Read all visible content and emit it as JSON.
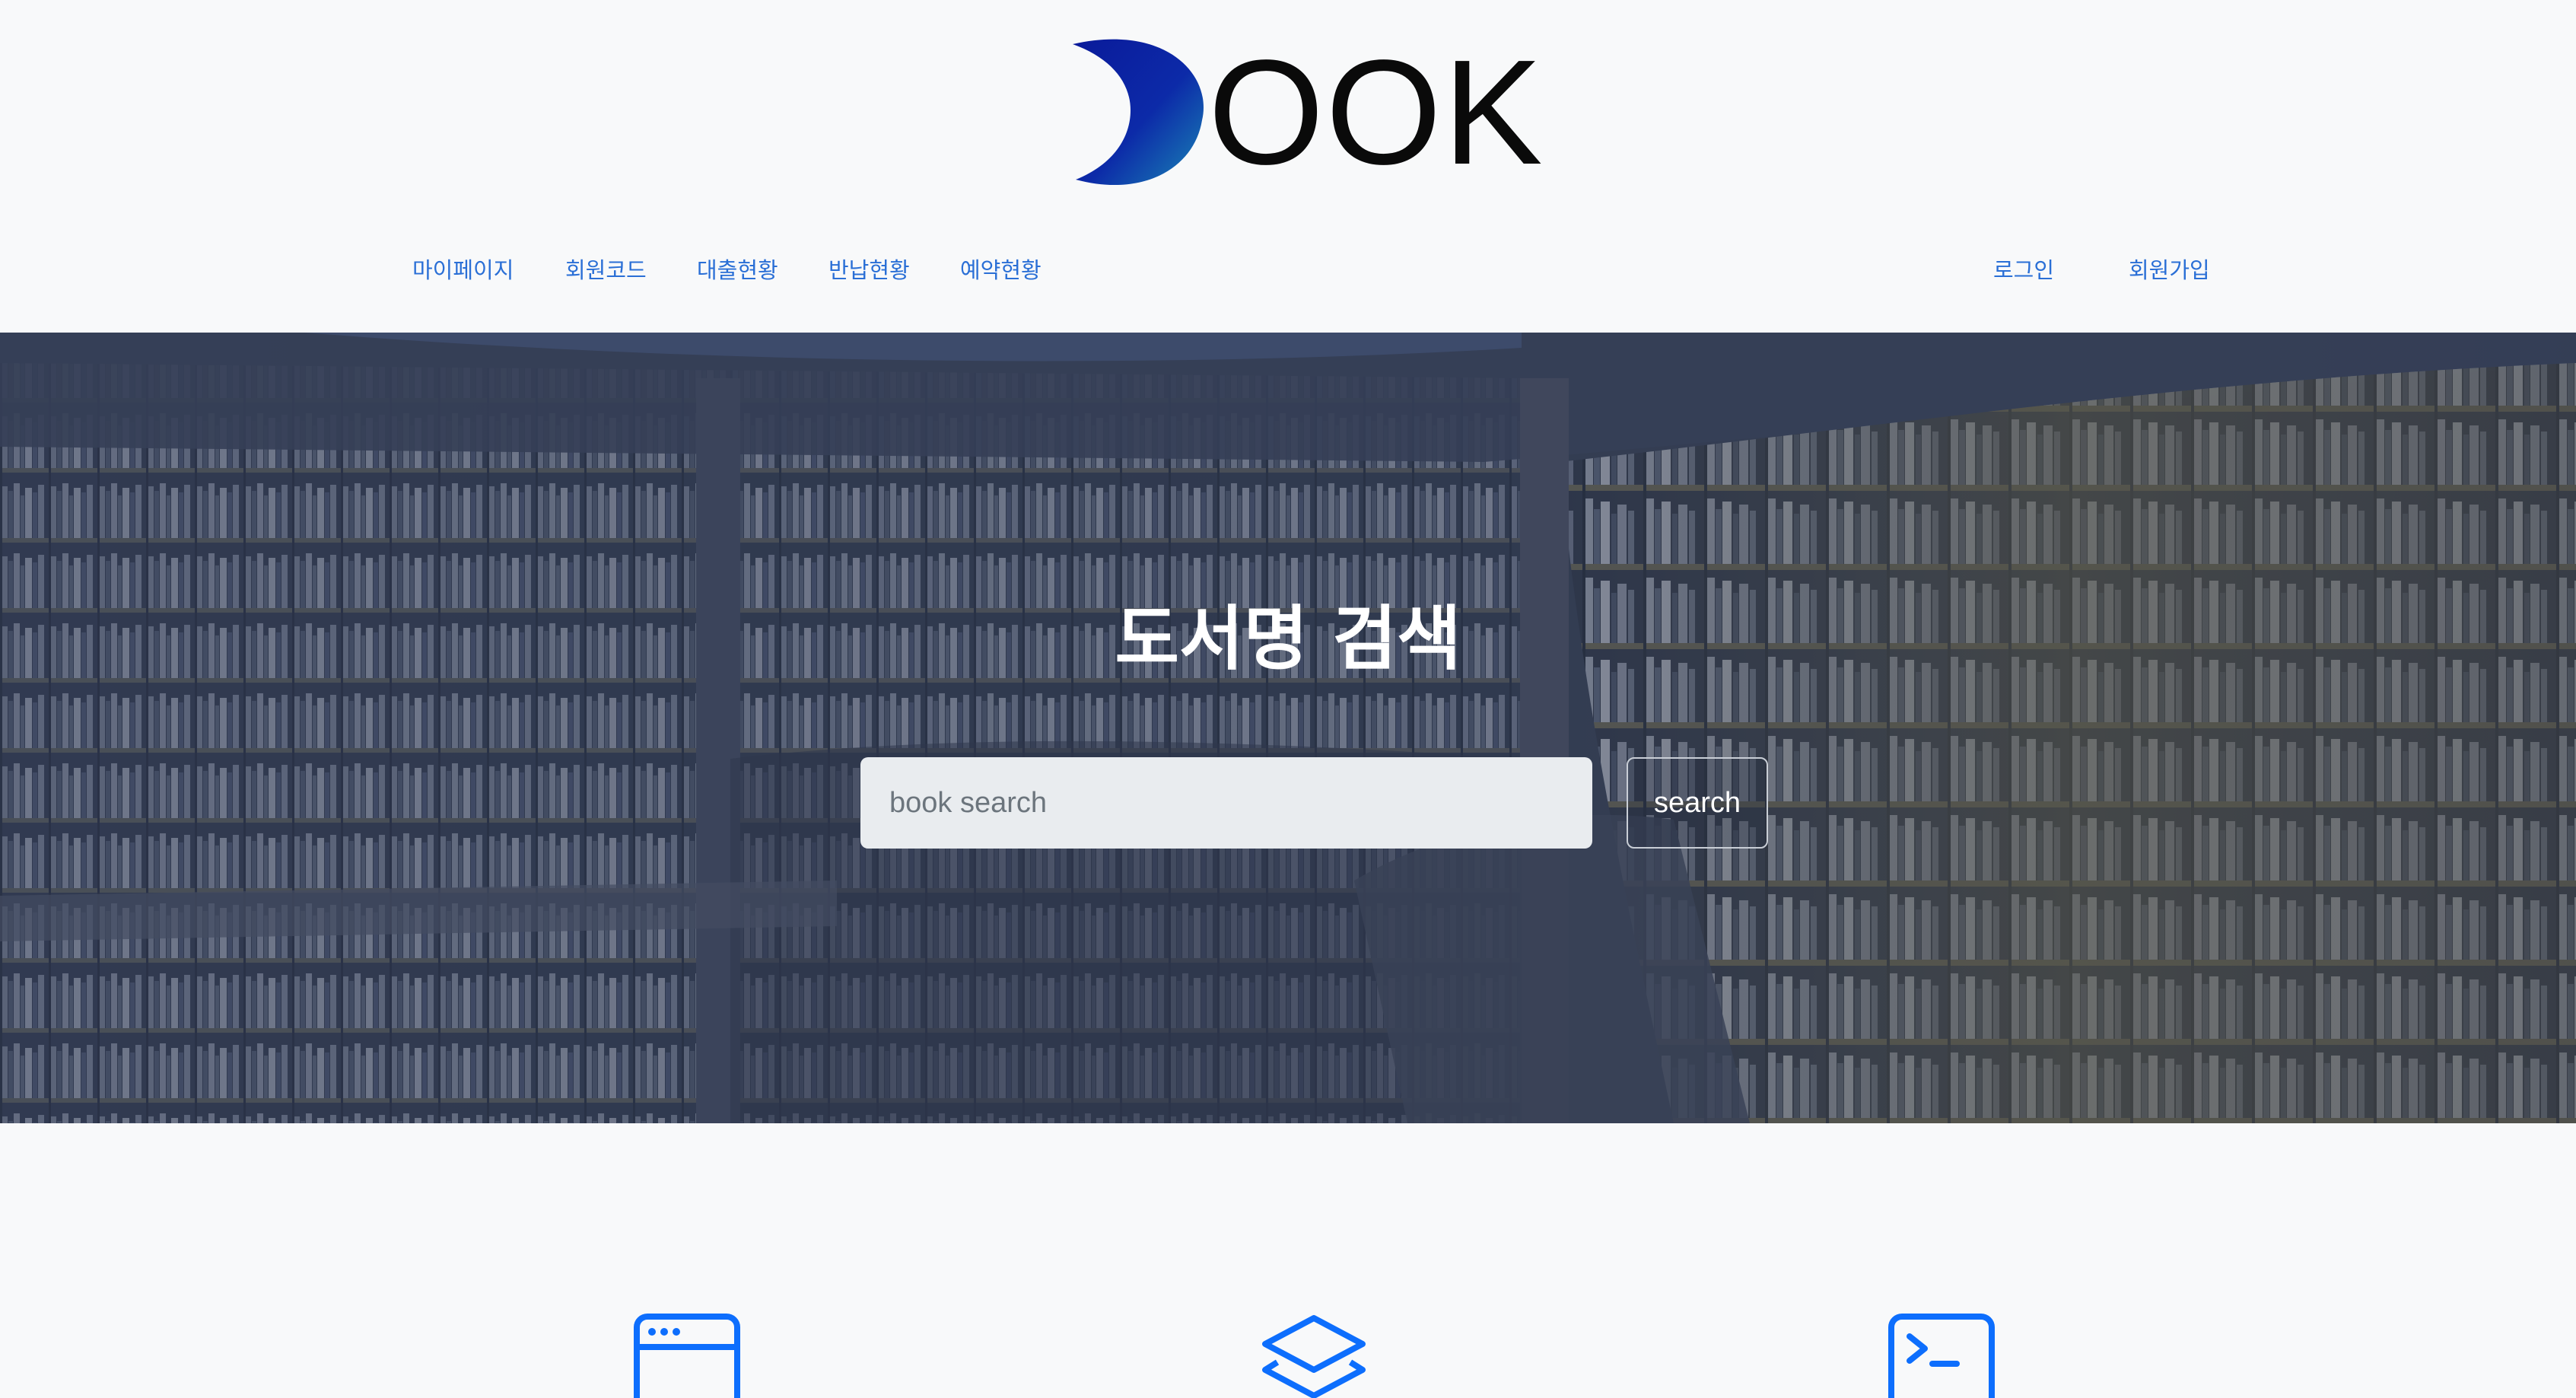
{
  "header": {
    "logo_text": "OOK",
    "brand_colors": {
      "crescent_start": "#0a1a9a",
      "crescent_end": "#1a7fb5"
    }
  },
  "nav": {
    "left": [
      {
        "label": "마이페이지"
      },
      {
        "label": "회원코드"
      },
      {
        "label": "대출현황"
      },
      {
        "label": "반납현황"
      },
      {
        "label": "예약현황"
      }
    ],
    "right": [
      {
        "label": "로그인"
      },
      {
        "label": "회원가입"
      }
    ],
    "link_color": "#2a6fd6"
  },
  "hero": {
    "title": "도서명 검색",
    "search": {
      "placeholder": "book search",
      "value": "",
      "button_label": "search"
    }
  },
  "features": {
    "icons": [
      "browser-window-icon",
      "layers-icon",
      "terminal-icon"
    ],
    "icon_color": "#0d6efd"
  }
}
